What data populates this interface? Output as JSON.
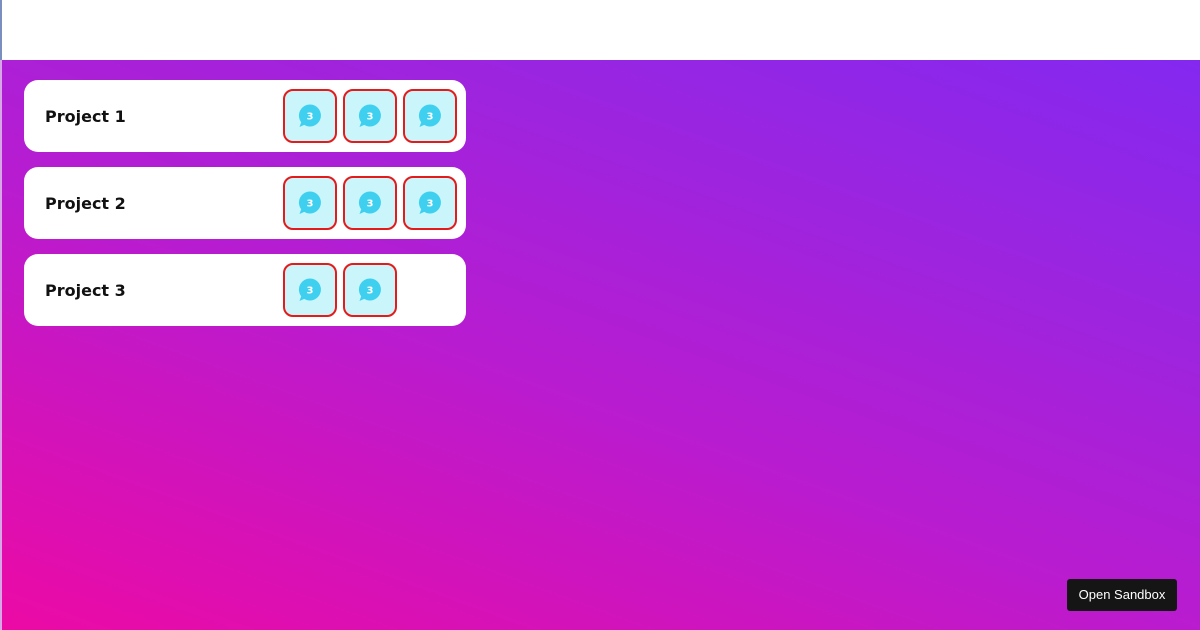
{
  "projects": [
    {
      "name": "Project 1",
      "badges": [
        {
          "count": "3",
          "icon": "chat-bubble-icon"
        },
        {
          "count": "3",
          "icon": "chat-bubble-icon"
        },
        {
          "count": "3",
          "icon": "chat-bubble-icon"
        }
      ]
    },
    {
      "name": "Project 2",
      "badges": [
        {
          "count": "3",
          "icon": "chat-bubble-icon"
        },
        {
          "count": "3",
          "icon": "chat-bubble-icon"
        },
        {
          "count": "3",
          "icon": "chat-bubble-icon"
        }
      ]
    },
    {
      "name": "Project 3",
      "badges": [
        {
          "count": "3",
          "icon": "chat-bubble-icon"
        },
        {
          "count": "3",
          "icon": "chat-bubble-icon"
        }
      ]
    }
  ],
  "sandbox_button": {
    "label": "Open Sandbox"
  },
  "colors": {
    "icon_fill": "#3fd0f0",
    "tile_background": "#c9f5fb",
    "tile_border": "#e31b1b",
    "gradient_start": "#ec0aa5",
    "gradient_end": "#8428f0"
  }
}
